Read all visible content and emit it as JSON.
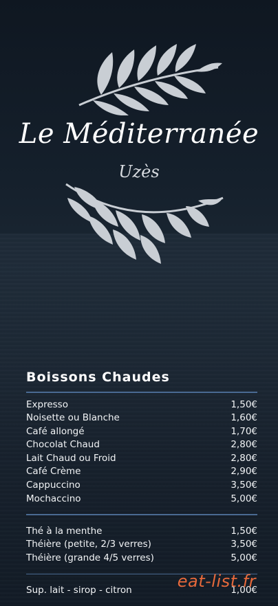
{
  "restaurant": {
    "name": "Le Méditerranée",
    "city": "Uzès"
  },
  "menu": {
    "section_title": "Boissons Chaudes",
    "groups": [
      [
        {
          "name": "Expresso",
          "price": "1,50€"
        },
        {
          "name": "Noisette ou Blanche",
          "price": "1,60€"
        },
        {
          "name": "Café allongé",
          "price": "1,70€"
        },
        {
          "name": "Chocolat Chaud",
          "price": "2,80€"
        },
        {
          "name": "Lait Chaud ou Froid",
          "price": "2,80€"
        },
        {
          "name": "Café Crème",
          "price": "2,90€"
        },
        {
          "name": "Cappuccino",
          "price": "3,50€"
        },
        {
          "name": "Mochaccino",
          "price": "5,00€"
        }
      ],
      [
        {
          "name": "Thé à la menthe",
          "price": "1,50€"
        },
        {
          "name": "Théière (petite, 2/3 verres)",
          "price": "3,50€"
        },
        {
          "name": "Théière (grande 4/5 verres)",
          "price": "5,00€"
        }
      ],
      [
        {
          "name": "Sup. lait - sirop - citron",
          "price": "1,00€"
        }
      ]
    ]
  },
  "watermark": "eat-list.fr",
  "colors": {
    "background": "#141e29",
    "divider": "#4a6a92",
    "watermark": "#e6693b",
    "leaf": "#c9ced4"
  },
  "icons": {
    "top_ornament": "olive-branch-icon",
    "bottom_ornament": "olive-branch-icon"
  }
}
